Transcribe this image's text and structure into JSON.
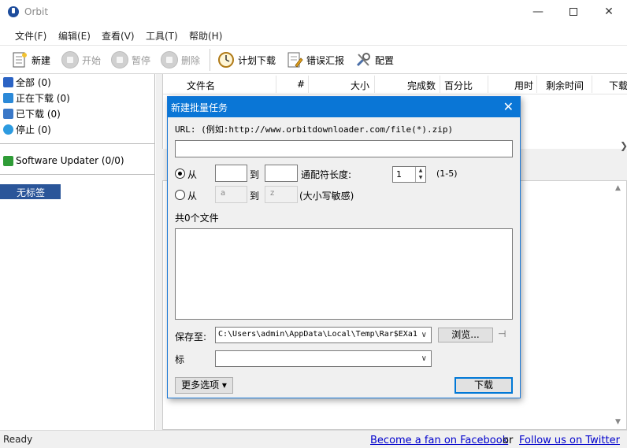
{
  "app": {
    "title": "Orbit"
  },
  "menu": [
    "文件(F)",
    "编辑(E)",
    "查看(V)",
    "工具(T)",
    "帮助(H)"
  ],
  "toolbar": {
    "new": "新建",
    "start": "开始",
    "pause": "暂停",
    "delete": "删除",
    "schedule": "计划下载",
    "report": "错误汇报",
    "settings": "配置"
  },
  "categories": [
    {
      "label": "全部 (0)",
      "color": "#2b63c4"
    },
    {
      "label": "正在下载 (0)",
      "color": "#2b89d8"
    },
    {
      "label": "已下载 (0)",
      "color": "#3a78c8"
    },
    {
      "label": "停止 (0)",
      "color": "#2d9be0"
    }
  ],
  "updater": {
    "label": "Software Updater (0/0)",
    "color": "#2f9c37"
  },
  "tags": {
    "selected": "无标签 (0)"
  },
  "columns": [
    "文件名",
    "#",
    "大小",
    "完成数",
    "百分比",
    "用时",
    "剩余时间",
    "下载"
  ],
  "status": {
    "text": "Ready",
    "facebook": "Become a fan on Facebook",
    "or": "or",
    "twitter": "Follow us on Twitter"
  },
  "dialog": {
    "title": "新建批量任务",
    "url_hint": "URL: (例如:http://www.orbitdownloader.com/file(*).zip)",
    "url_value": "",
    "from_label": "从",
    "to_label": "到",
    "wildcard_label": "通配符长度:",
    "wildcard_value": "1",
    "wildcard_range": "(1-5)",
    "alpha_from": "a",
    "alpha_to": "z",
    "case_note": "(大小写敏感)",
    "file_count": "共0个文件",
    "save_label": "保存至:",
    "save_path": "C:\\Users\\admin\\AppData\\Local\\Temp\\Rar$EXa1",
    "browse": "浏览...",
    "tag_label": "标",
    "more_options": "更多选项 ▾",
    "download": "下载"
  }
}
